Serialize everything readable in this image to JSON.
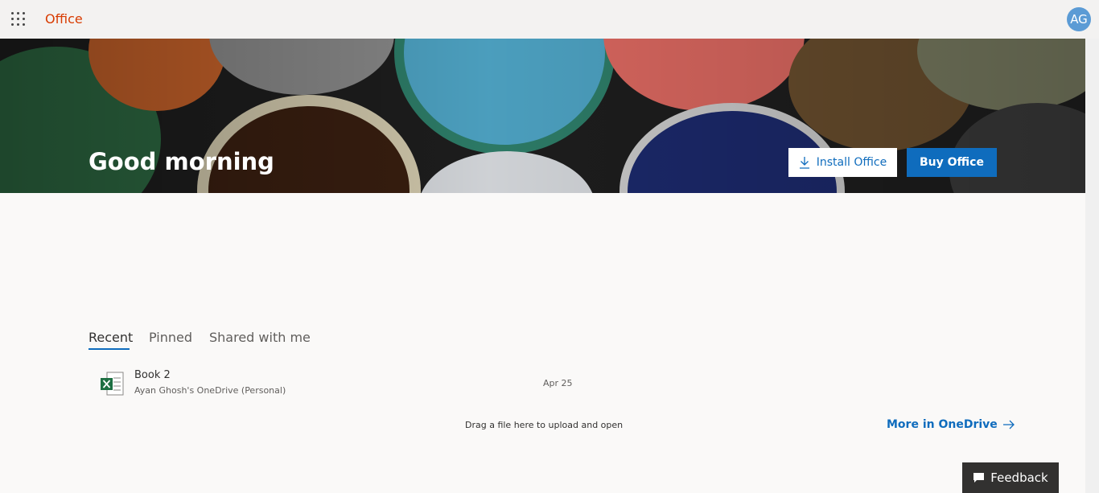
{
  "header": {
    "brand": "Office",
    "user_initials": "AG"
  },
  "hero": {
    "greeting": "Good morning",
    "install_label": "Install Office",
    "buy_label": "Buy Office"
  },
  "tabs": [
    {
      "label": "Recent",
      "active": true
    },
    {
      "label": "Pinned",
      "active": false
    },
    {
      "label": "Shared with me",
      "active": false
    }
  ],
  "files": [
    {
      "name": "Book 2",
      "location": "Ayan Ghosh's OneDrive (Personal)",
      "date": "Apr 25",
      "icon": "excel-icon"
    }
  ],
  "footer": {
    "drop_hint": "Drag a file here to upload and open",
    "more_link": "More in OneDrive",
    "feedback_label": "Feedback"
  },
  "colors": {
    "brand": "#d83b01",
    "accent": "#0f6cbd",
    "avatar": "#5b9bd5",
    "excel": "#1d6f42"
  }
}
